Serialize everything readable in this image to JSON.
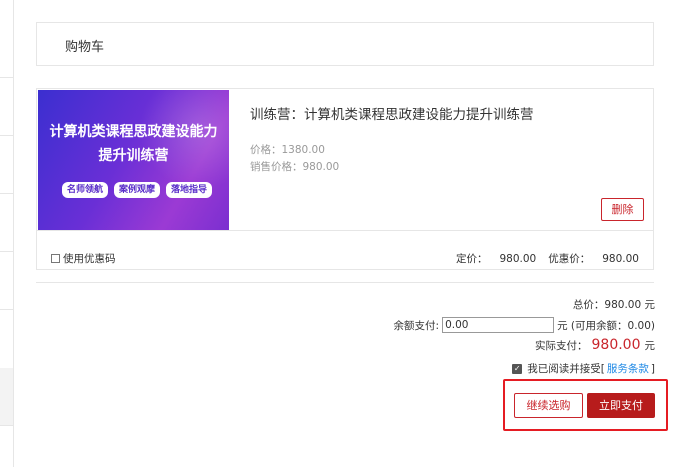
{
  "page": {
    "title": "购物车"
  },
  "cart_item": {
    "banner": {
      "line1": "计算机类课程思政建设能力",
      "line2": "提升训练营",
      "tags": [
        "名师领航",
        "案例观摩",
        "落地指导"
      ]
    },
    "name": "训练营：计算机类课程思政建设能力提升训练营",
    "price_label": "价格：",
    "price_value": "1380.00",
    "sale_label": "销售价格：",
    "sale_value": "980.00",
    "delete_label": "删除",
    "coupon_label": "使用优惠码",
    "list_price_label": "定价：",
    "list_price_value": "980.00",
    "discount_price_label": "优惠价：",
    "discount_price_value": "980.00"
  },
  "summary": {
    "total_label": "总价：",
    "total_value": "980.00",
    "currency": "元",
    "balance_label": "余额支付:",
    "balance_input_value": "0.00",
    "balance_available": "元 (可用余额：0.00)",
    "actual_label": "实际支付：",
    "actual_value": "980.00",
    "agree_text": "我已阅读并接受[",
    "terms_label": "服务条款",
    "agree_close": "]"
  },
  "actions": {
    "continue_label": "继续选购",
    "pay_label": "立即支付"
  },
  "colors": {
    "accent": "#c9252c",
    "pay_button": "#b71c1c",
    "link": "#1e88e5",
    "highlight": "#e51c23"
  }
}
